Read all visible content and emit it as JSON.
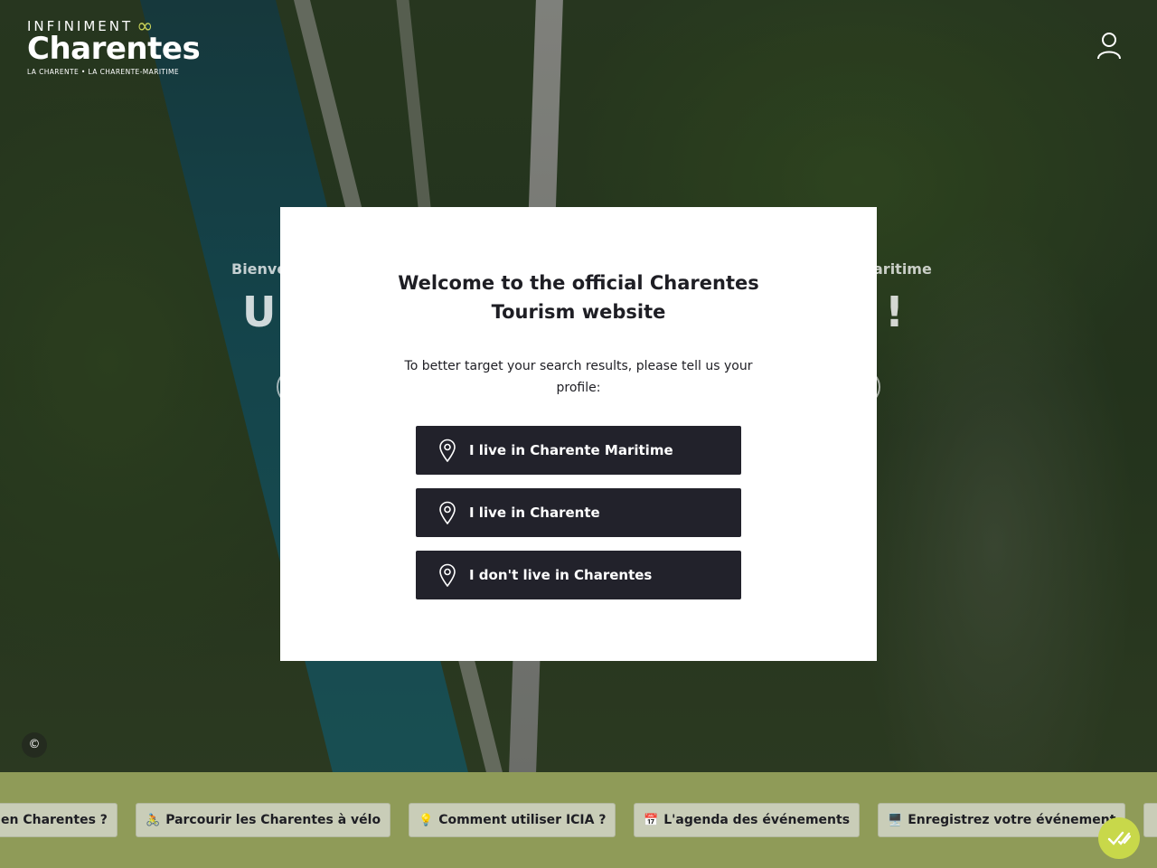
{
  "header": {
    "logo_top": "INFINIMENT",
    "logo_main": "Charentes",
    "logo_sub": "LA CHARENTE • LA CHARENTE-MARITIME",
    "user_icon": "user-icon"
  },
  "hero": {
    "kicker_left": "Bienve",
    "kicker_right": "aritime",
    "title_left": "U",
    "title_right": "d !",
    "copyright": "©"
  },
  "modal": {
    "title": "Welcome to the official Charentes Tourism website",
    "text": "To better target your search results, please tell us your profile:",
    "choices": [
      {
        "label": "I live in Charente Maritime",
        "icon": "map-pin-icon"
      },
      {
        "label": "I live in Charente",
        "icon": "map-pin-icon"
      },
      {
        "label": "I don't live in Charentes",
        "icon": "map-pin-icon"
      }
    ]
  },
  "strip": {
    "chips": [
      {
        "emoji": "",
        "label": "en Charentes ?"
      },
      {
        "emoji": "🚴",
        "label": "Parcourir les Charentes à vélo"
      },
      {
        "emoji": "💡",
        "label": "Comment utiliser ICIA ?"
      },
      {
        "emoji": "📅",
        "label": "L'agenda des événements"
      },
      {
        "emoji": "🖥️",
        "label": "Enregistrez votre événement"
      }
    ]
  },
  "colors": {
    "modal_button": "#22222b",
    "strip_bg": "#8f9b58",
    "accent": "#c8d84a"
  }
}
